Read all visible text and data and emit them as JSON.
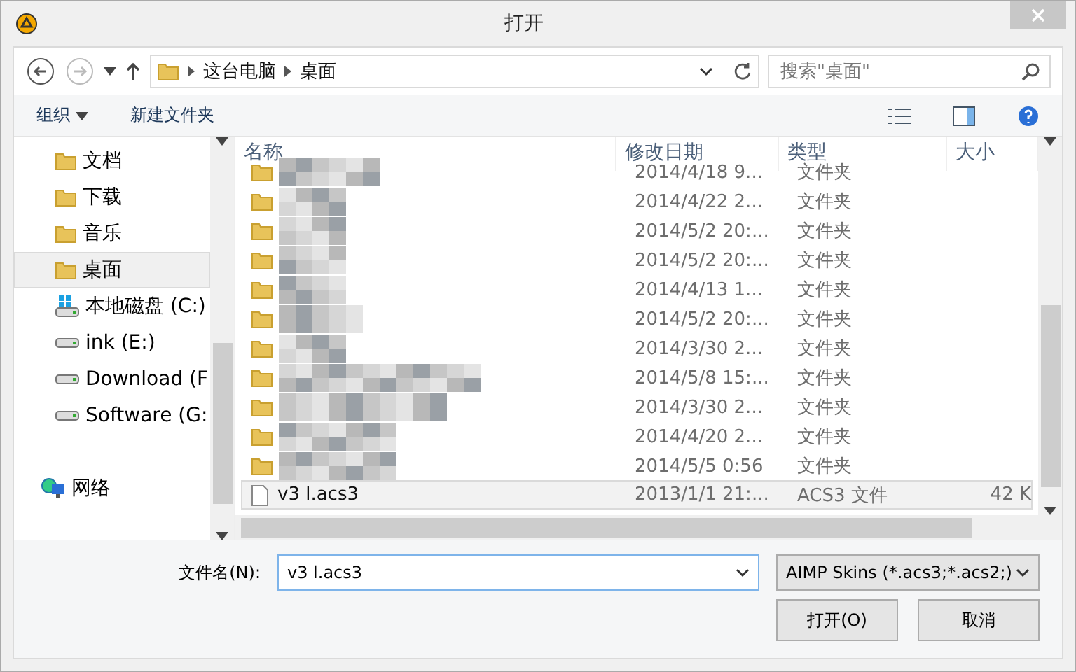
{
  "window": {
    "title": "打开"
  },
  "nav": {
    "breadcrumb": [
      "这台电脑",
      "桌面"
    ],
    "search": {
      "placeholder": "搜索\"桌面\""
    }
  },
  "toolbar": {
    "organize": "组织",
    "new_folder": "新建文件夹"
  },
  "sidebar": {
    "items": [
      {
        "label": "文档",
        "kind": "folder",
        "selected": false
      },
      {
        "label": "下载",
        "kind": "folder",
        "selected": false
      },
      {
        "label": "音乐",
        "kind": "folder",
        "selected": false
      },
      {
        "label": "桌面",
        "kind": "folder",
        "selected": true
      },
      {
        "label": "本地磁盘 (C:)",
        "kind": "system-drive",
        "selected": false
      },
      {
        "label": "ink (E:)",
        "kind": "drive",
        "selected": false
      },
      {
        "label": "Download (F",
        "kind": "drive",
        "selected": false
      },
      {
        "label": "Software (G:",
        "kind": "drive",
        "selected": false
      },
      {
        "label": "网络",
        "kind": "network",
        "selected": false
      }
    ]
  },
  "table": {
    "columns": [
      "名称",
      "修改日期",
      "类型",
      "大小"
    ],
    "rows": [
      {
        "kind": "folder",
        "date": "2014/4/18 9...",
        "type": "文件夹",
        "selected": false
      },
      {
        "kind": "folder",
        "date": "2014/4/22 2...",
        "type": "文件夹",
        "selected": false
      },
      {
        "kind": "folder",
        "date": "2014/5/2 20:...",
        "type": "文件夹",
        "selected": false
      },
      {
        "kind": "folder",
        "date": "2014/5/2 20:...",
        "type": "文件夹",
        "selected": false
      },
      {
        "kind": "folder",
        "date": "2014/4/13 1...",
        "type": "文件夹",
        "selected": false
      },
      {
        "kind": "folder",
        "date": "2014/5/2 20:...",
        "type": "文件夹",
        "selected": false
      },
      {
        "kind": "folder",
        "date": "2014/3/30 2...",
        "type": "文件夹",
        "selected": false
      },
      {
        "kind": "folder",
        "date": "2014/5/8 15:...",
        "type": "文件夹",
        "selected": false
      },
      {
        "kind": "folder",
        "date": "2014/3/30 2...",
        "type": "文件夹",
        "selected": false
      },
      {
        "kind": "folder",
        "date": "2014/4/20 2...",
        "type": "文件夹",
        "selected": false
      },
      {
        "kind": "folder",
        "date": "2014/5/5 0:56",
        "type": "文件夹",
        "selected": false
      },
      {
        "kind": "file",
        "name": "v3 l.acs3",
        "date": "2013/1/1 21:...",
        "type": "ACS3 文件",
        "size": "42 K",
        "selected": true
      }
    ]
  },
  "footer": {
    "filename_label": "文件名(N):",
    "filename": "v3 l.acs3",
    "filter": "AIMP Skins (*.acs3;*.acs2;)",
    "open": "打开(O)",
    "cancel": "取消"
  }
}
